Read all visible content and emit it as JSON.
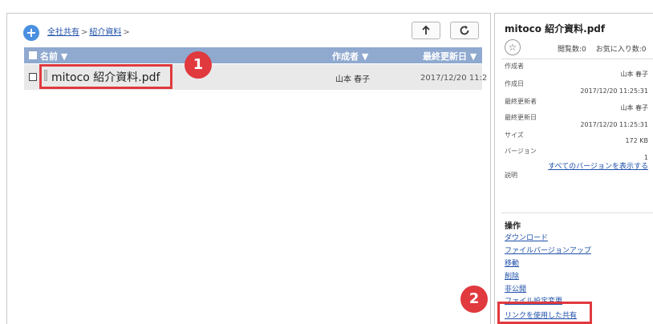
{
  "breadcrumb": {
    "items": [
      "全社共有",
      "紹介資料"
    ],
    "separator": ">"
  },
  "icons": {
    "add": "plus-icon",
    "up": "arrow-up-icon",
    "refresh": "refresh-icon",
    "star": "star-icon",
    "file": "file-icon"
  },
  "table": {
    "headers": {
      "name": "名前 ▼",
      "author": "作成者 ▼",
      "updated": "最終更新日 ▼"
    },
    "rows": [
      {
        "name": "mitoco 紹介資料.pdf",
        "author": "山本 春子",
        "updated": "2017/12/20 11:2"
      }
    ]
  },
  "annotations": {
    "badge1": "1",
    "badge2": "2",
    "highlight_color": "#e0393e"
  },
  "details": {
    "title": "mitoco 紹介資料.pdf",
    "views": "閲覧数:0",
    "favorites": "お気に入り数:0",
    "creator_label": "作成者",
    "creator_value": "山本 春子",
    "created_label": "作成日",
    "created_value": "2017/12/20 11:25:31",
    "last_updater_label": "最終更新者",
    "last_updater_value": "山本 春子",
    "last_updated_label": "最終更新日",
    "last_updated_value": "2017/12/20 11:25:31",
    "size_label": "サイズ",
    "size_value": "172 KB",
    "version_label": "バージョン",
    "version_value": "1",
    "all_versions_link": "すべてのバージョンを表示する",
    "description_label": "説明"
  },
  "operations": {
    "title": "操作",
    "items": [
      "ダウンロード",
      "ファイルバージョンアップ",
      "移動",
      "削除",
      "非公開",
      "ファイル設定変更",
      "リンクを使用した共有"
    ]
  },
  "colors": {
    "header_bg": "#8fa9cf",
    "link": "#1e4fa8",
    "add_button": "#4a8fe0"
  }
}
